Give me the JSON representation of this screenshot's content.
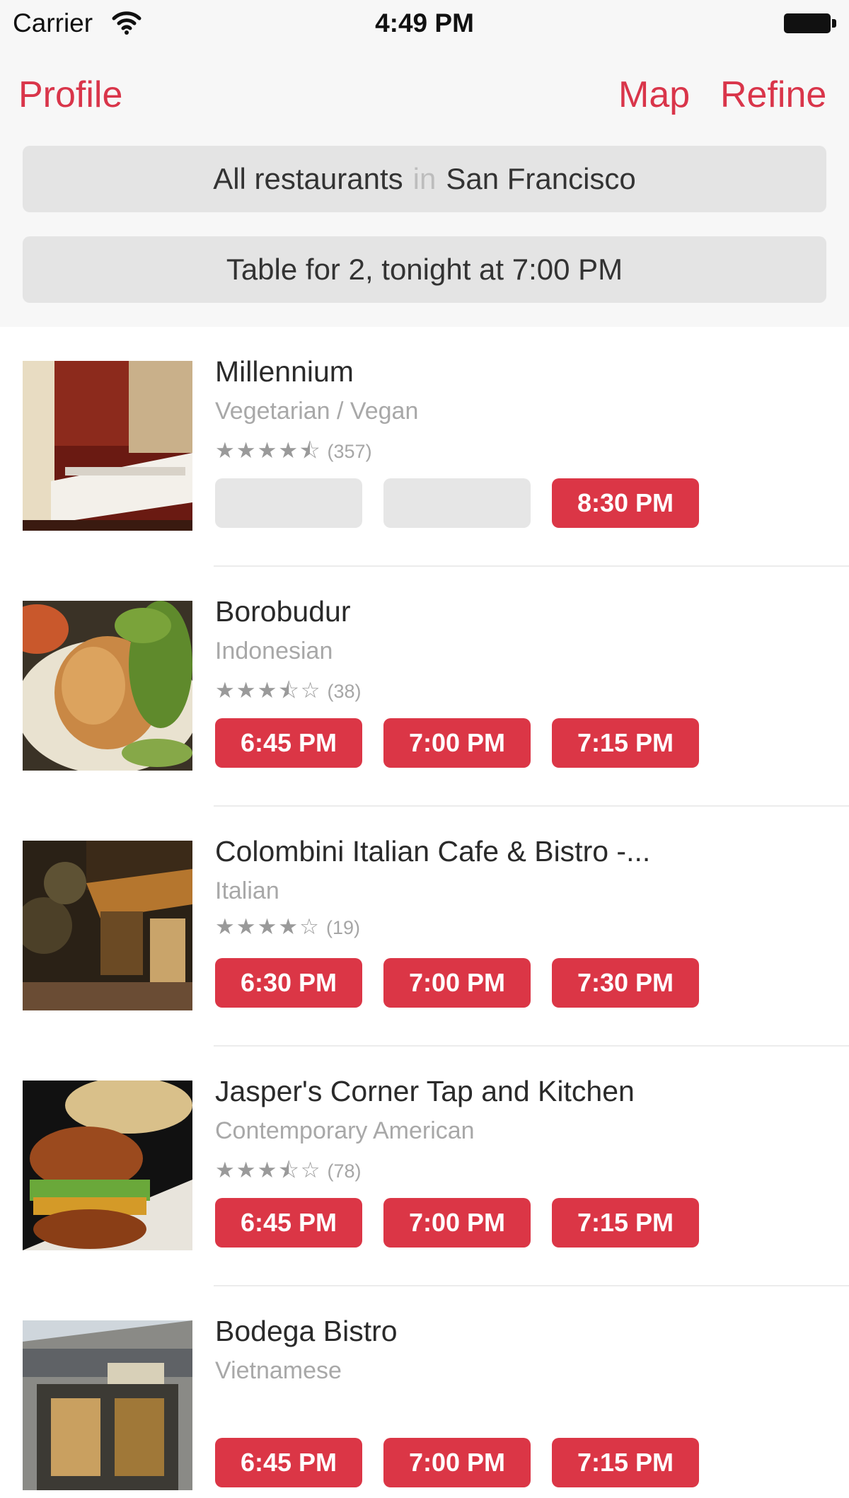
{
  "status_bar": {
    "carrier": "Carrier",
    "time": "4:49 PM"
  },
  "nav": {
    "profile": "Profile",
    "map": "Map",
    "refine": "Refine"
  },
  "search": {
    "category": "All restaurants",
    "in_word": "in",
    "city": "San Francisco",
    "reservation": "Table for 2, tonight at 7:00 PM"
  },
  "colors": {
    "accent": "#d9354a",
    "slot": "#db3646",
    "slot_empty": "#e6e6e6"
  },
  "restaurants": [
    {
      "name": "Millennium",
      "cuisine": "Vegetarian / Vegan",
      "stars": "★★★★⯪",
      "rating_value": 4.5,
      "reviews": "(357)",
      "slots": [
        "",
        "",
        "8:30 PM"
      ]
    },
    {
      "name": "Borobudur",
      "cuisine": "Indonesian",
      "stars": "★★★⯪☆",
      "rating_value": 3.5,
      "reviews": "(38)",
      "slots": [
        "6:45 PM",
        "7:00 PM",
        "7:15 PM"
      ]
    },
    {
      "name": "Colombini Italian Cafe & Bistro -...",
      "cuisine": "Italian",
      "stars": "★★★★☆",
      "rating_value": 4,
      "reviews": "(19)",
      "slots": [
        "6:30 PM",
        "7:00 PM",
        "7:30 PM"
      ]
    },
    {
      "name": "Jasper's Corner Tap and Kitchen",
      "cuisine": "Contemporary American",
      "stars": "★★★⯪☆",
      "rating_value": 3.5,
      "reviews": "(78)",
      "slots": [
        "6:45 PM",
        "7:00 PM",
        "7:15 PM"
      ]
    },
    {
      "name": "Bodega Bistro",
      "cuisine": "Vietnamese",
      "stars": "",
      "reviews": "",
      "slots": [
        "6:45 PM",
        "7:00 PM",
        "7:15 PM"
      ]
    }
  ]
}
